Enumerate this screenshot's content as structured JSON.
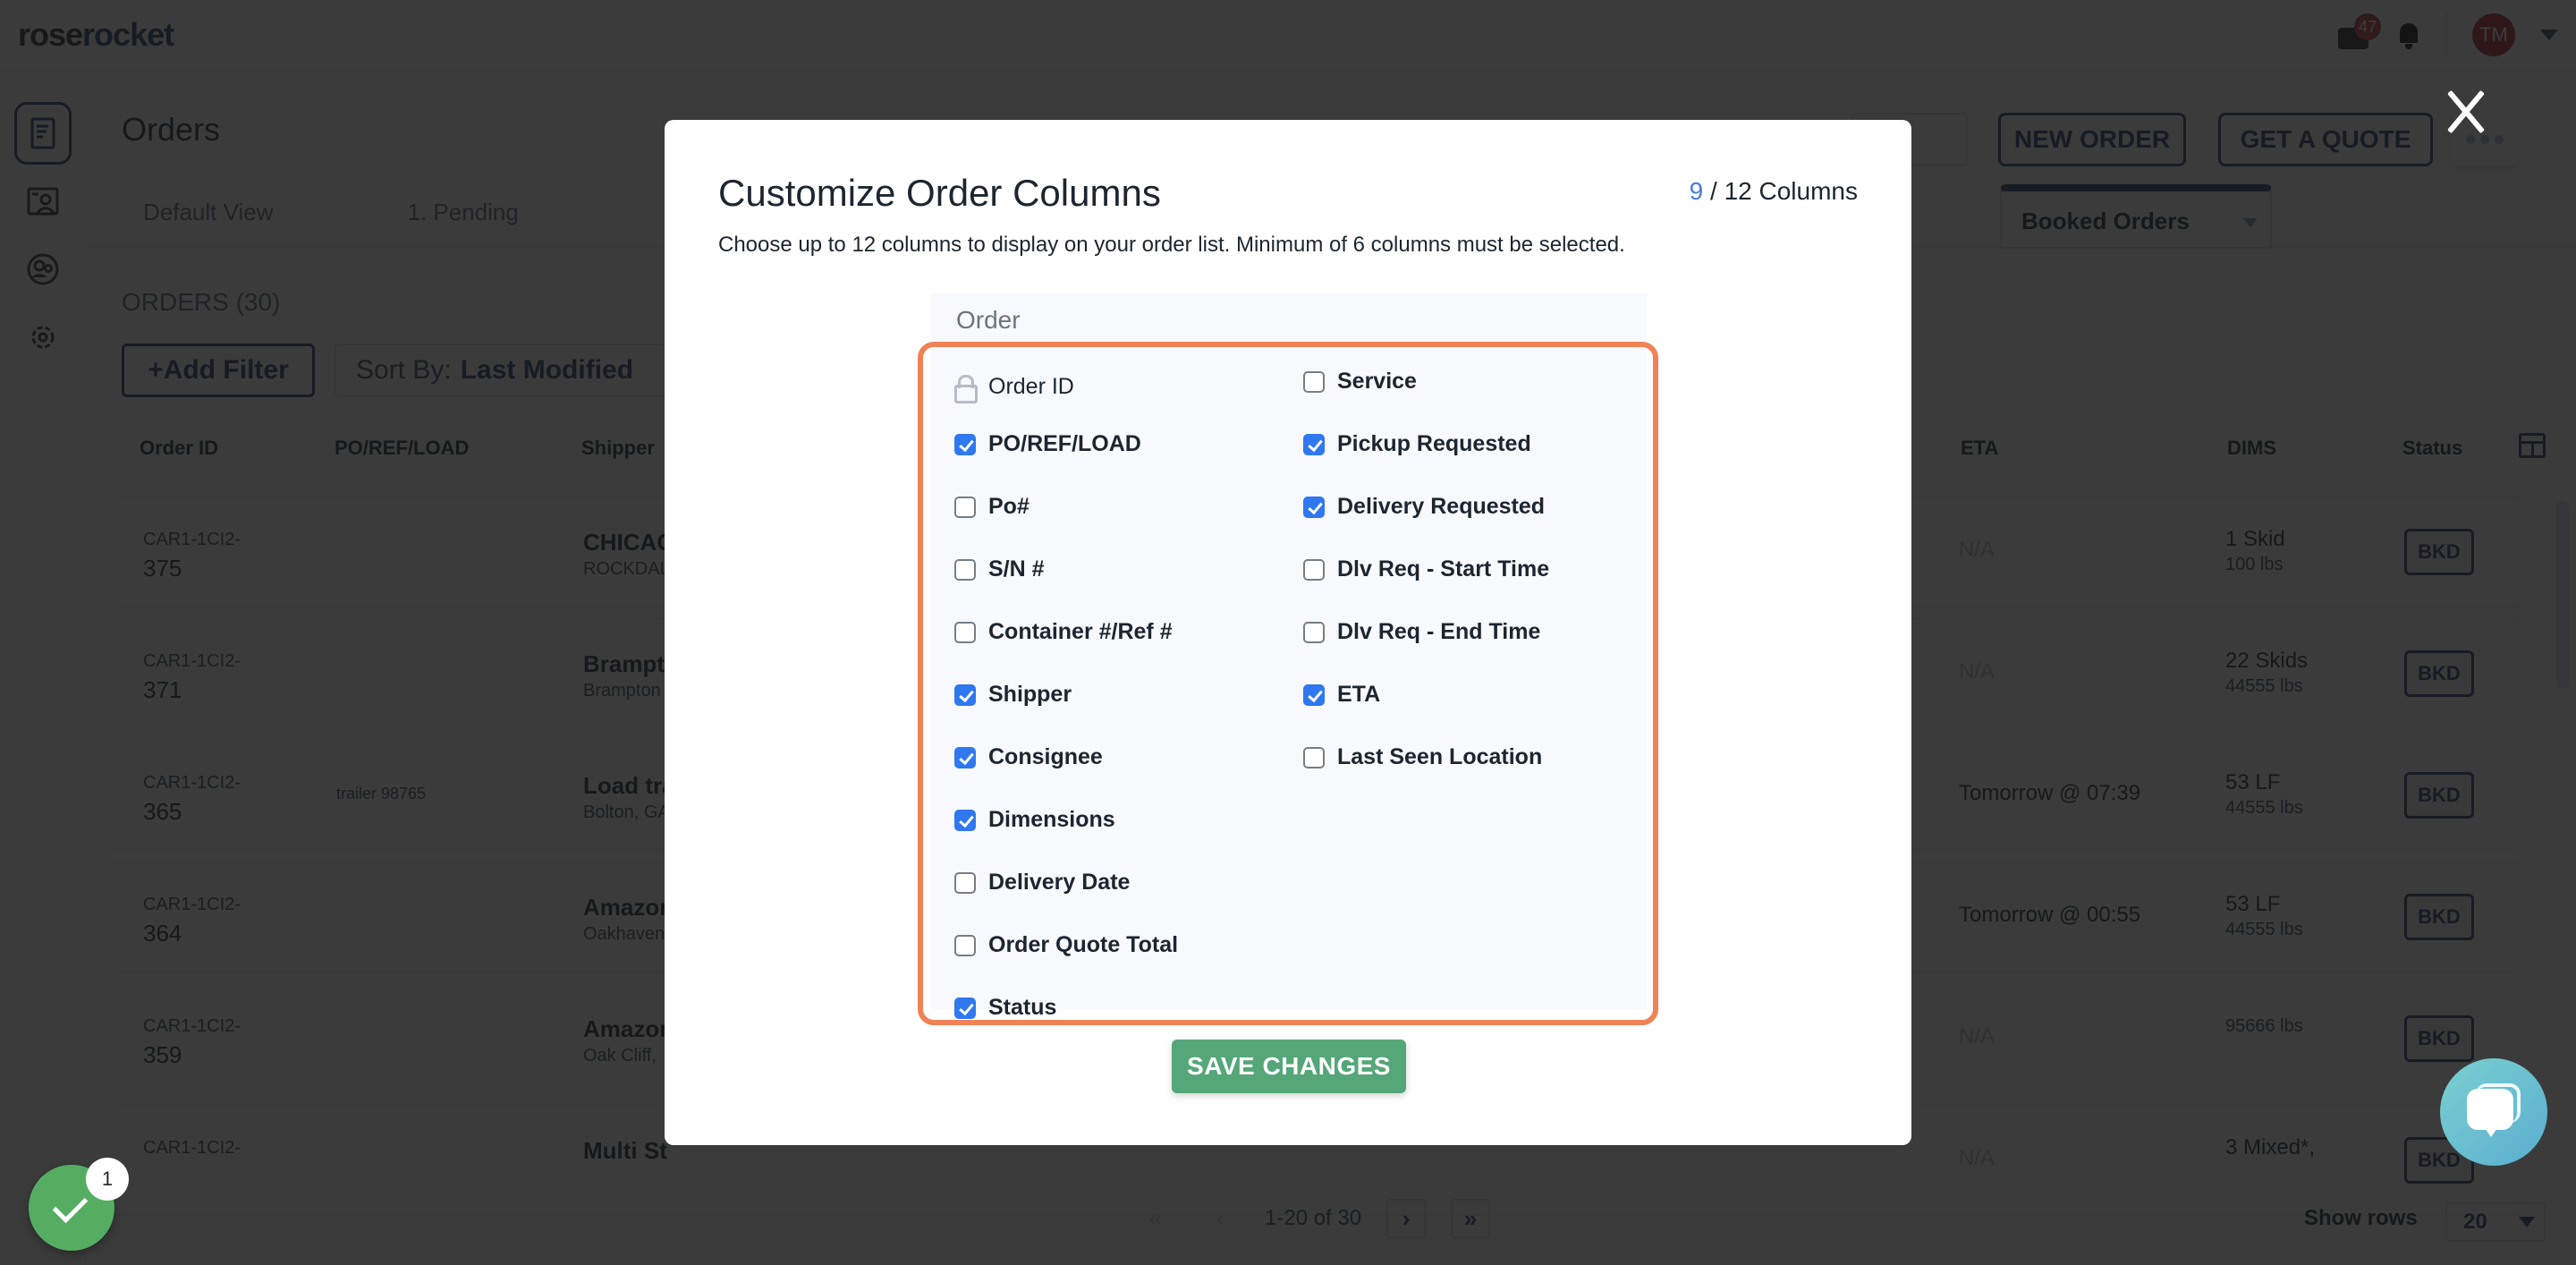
{
  "app": {
    "logo_part1": "rose",
    "logo_part2": "rocket",
    "inbox_badge": "47",
    "avatar_initials": "TM"
  },
  "sidebar": {
    "items": [
      {
        "name": "orders",
        "icon": "document-icon",
        "active": true
      },
      {
        "name": "contacts",
        "icon": "contact-card-icon",
        "active": false
      },
      {
        "name": "users",
        "icon": "users-icon",
        "active": false
      },
      {
        "name": "settings",
        "icon": "gear-icon",
        "active": false
      }
    ]
  },
  "page": {
    "title": "Orders",
    "view_tabs": [
      "Default View",
      "1. Pending"
    ],
    "booked_view": "Booked Orders",
    "new_order_label": "NEW ORDER",
    "get_quote_label": "GET A QUOTE",
    "orders_count": "ORDERS (30)",
    "add_filter_label": "+Add Filter",
    "sort_by_label": "Sort By:",
    "sort_by_value": "Last Modified"
  },
  "table": {
    "headers": {
      "order_id": "Order ID",
      "po": "PO/REF/LOAD",
      "shipper": "Shipper",
      "eta": "ETA",
      "dims": "DIMS",
      "status": "Status"
    },
    "rows": [
      {
        "id_prefix": "CAR1-1CI2-",
        "id_num": "375",
        "po": "",
        "shipper": "CHICAG",
        "shipper_loc": "ROCKDAL",
        "eta": "N/A",
        "dims": "1 Skid",
        "weight": "100 lbs",
        "status": "BKD"
      },
      {
        "id_prefix": "CAR1-1CI2-",
        "id_num": "371",
        "po": "",
        "shipper": "Brampt",
        "shipper_loc": "Brampton",
        "eta": "N/A",
        "dims": "22 Skids",
        "weight": "44555 lbs",
        "status": "BKD"
      },
      {
        "id_prefix": "CAR1-1CI2-",
        "id_num": "365",
        "po": "trailer 98765",
        "shipper": "Load tra",
        "shipper_loc": "Bolton, GA",
        "eta": "Tomorrow @ 07:39",
        "dims": "53 LF",
        "weight": "44555 lbs",
        "status": "BKD"
      },
      {
        "id_prefix": "CAR1-1CI2-",
        "id_num": "364",
        "po": "",
        "shipper": "Amazon",
        "shipper_loc": "Oakhaven",
        "eta": "Tomorrow @ 00:55",
        "dims": "53 LF",
        "weight": "44555 lbs",
        "status": "BKD"
      },
      {
        "id_prefix": "CAR1-1CI2-",
        "id_num": "359",
        "po": "",
        "shipper": "Amazon",
        "shipper_loc": "Oak Cliff,",
        "eta": "N/A",
        "dims": "",
        "weight": "95666 lbs",
        "status": "BKD"
      },
      {
        "id_prefix": "CAR1-1CI2-",
        "id_num": "",
        "po": "",
        "shipper": "Multi St",
        "shipper_loc": "",
        "eta": "N/A",
        "dims": "3 Mixed*,",
        "weight": "",
        "status": "BKD"
      }
    ]
  },
  "pagination": {
    "range": "1-20 of 30",
    "show_rows_label": "Show rows",
    "rows_per_page": "20"
  },
  "modal": {
    "title": "Customize Order Columns",
    "selected_count": "9",
    "max_label": " / 12 Columns",
    "subtitle": "Choose up to 12 columns to display on your order list. Minimum of 6 columns must be selected.",
    "section_label": "Order",
    "left_options": [
      {
        "label": "Order ID",
        "locked": true,
        "checked": true
      },
      {
        "label": "PO/REF/LOAD",
        "checked": true
      },
      {
        "label": "Po#",
        "checked": false
      },
      {
        "label": "S/N #",
        "checked": false
      },
      {
        "label": "Container #/Ref #",
        "checked": false
      },
      {
        "label": "Shipper",
        "checked": true
      },
      {
        "label": "Consignee",
        "checked": true
      },
      {
        "label": "Dimensions",
        "checked": true
      },
      {
        "label": "Delivery Date",
        "checked": false
      },
      {
        "label": "Order Quote Total",
        "checked": false
      },
      {
        "label": "Status",
        "checked": true
      }
    ],
    "right_options": [
      {
        "label": "Service",
        "checked": false
      },
      {
        "label": "Pickup Requested",
        "checked": true
      },
      {
        "label": "Delivery Requested",
        "checked": true
      },
      {
        "label": "Dlv Req - Start Time",
        "checked": false
      },
      {
        "label": "Dlv Req - End Time",
        "checked": false
      },
      {
        "label": "ETA",
        "checked": true
      },
      {
        "label": "Last Seen Location",
        "checked": false
      }
    ],
    "save_label": "SAVE CHANGES",
    "highlight_color": "#ef8356"
  },
  "widgets": {
    "check_badge": "1"
  },
  "colors": {
    "brand_navy": "#1f3a6e",
    "checkbox_blue": "#2f78f0",
    "save_green": "#55a679",
    "counter_blue": "#4a7bd8"
  }
}
